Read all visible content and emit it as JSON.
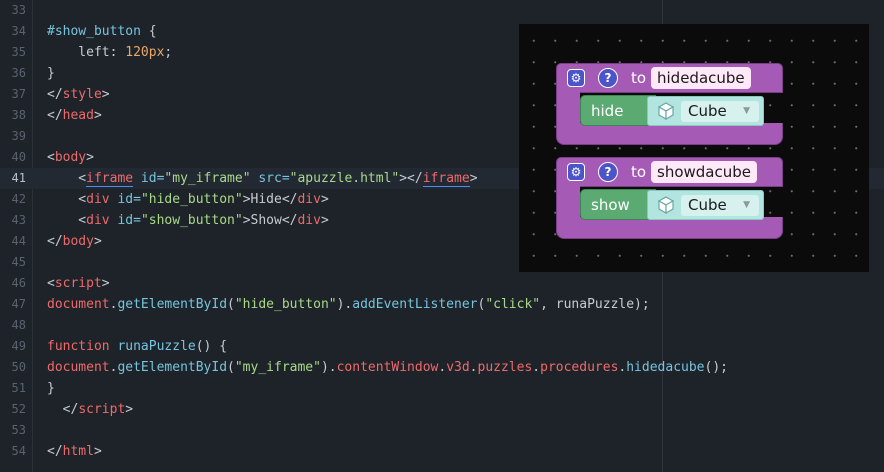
{
  "editor": {
    "current_line": 41,
    "lines": [
      {
        "num": "33",
        "tokens": []
      },
      {
        "num": "34",
        "tokens": [
          {
            "t": "#show_button",
            "c": "sel"
          },
          {
            "t": " {",
            "c": "plain"
          }
        ]
      },
      {
        "num": "35",
        "tokens": [
          {
            "t": "    left: ",
            "c": "plain"
          },
          {
            "t": "120px",
            "c": "num"
          },
          {
            "t": ";",
            "c": "plain"
          }
        ]
      },
      {
        "num": "36",
        "tokens": [
          {
            "t": "}",
            "c": "plain"
          }
        ]
      },
      {
        "num": "37",
        "tokens": [
          {
            "t": "</",
            "c": "plain"
          },
          {
            "t": "style",
            "c": "tag"
          },
          {
            "t": ">",
            "c": "plain"
          }
        ]
      },
      {
        "num": "38",
        "tokens": [
          {
            "t": "</",
            "c": "plain"
          },
          {
            "t": "head",
            "c": "tag"
          },
          {
            "t": ">",
            "c": "plain"
          }
        ]
      },
      {
        "num": "39",
        "tokens": []
      },
      {
        "num": "40",
        "tokens": [
          {
            "t": "<",
            "c": "plain"
          },
          {
            "t": "body",
            "c": "tag"
          },
          {
            "t": ">",
            "c": "plain"
          }
        ]
      },
      {
        "num": "41",
        "tokens": [
          {
            "t": "    <",
            "c": "plain"
          },
          {
            "t": "iframe",
            "c": "iframe"
          },
          {
            "t": " id=",
            "c": "attr"
          },
          {
            "t": "\"my_iframe\"",
            "c": "str"
          },
          {
            "t": " src=",
            "c": "attr"
          },
          {
            "t": "\"apuzzle.html\"",
            "c": "str"
          },
          {
            "t": "></",
            "c": "plain"
          },
          {
            "t": "iframe",
            "c": "iframe"
          },
          {
            "t": ">",
            "c": "plain"
          }
        ]
      },
      {
        "num": "42",
        "tokens": [
          {
            "t": "    <",
            "c": "plain"
          },
          {
            "t": "div",
            "c": "tag"
          },
          {
            "t": " id=",
            "c": "attr"
          },
          {
            "t": "\"hide_button\"",
            "c": "str"
          },
          {
            "t": ">Hide</",
            "c": "plain"
          },
          {
            "t": "div",
            "c": "tag"
          },
          {
            "t": ">",
            "c": "plain"
          }
        ]
      },
      {
        "num": "43",
        "tokens": [
          {
            "t": "    <",
            "c": "plain"
          },
          {
            "t": "div",
            "c": "tag"
          },
          {
            "t": " id=",
            "c": "attr"
          },
          {
            "t": "\"show_button\"",
            "c": "str"
          },
          {
            "t": ">Show</",
            "c": "plain"
          },
          {
            "t": "div",
            "c": "tag"
          },
          {
            "t": ">",
            "c": "plain"
          }
        ]
      },
      {
        "num": "44",
        "tokens": [
          {
            "t": "</",
            "c": "plain"
          },
          {
            "t": "body",
            "c": "tag"
          },
          {
            "t": ">",
            "c": "plain"
          }
        ]
      },
      {
        "num": "45",
        "tokens": []
      },
      {
        "num": "46",
        "tokens": [
          {
            "t": "<",
            "c": "plain"
          },
          {
            "t": "script",
            "c": "tag"
          },
          {
            "t": ">",
            "c": "plain"
          }
        ]
      },
      {
        "num": "47",
        "tokens": [
          {
            "t": "document",
            "c": "kw"
          },
          {
            "t": ".",
            "c": "plain"
          },
          {
            "t": "getElementById",
            "c": "fn"
          },
          {
            "t": "(",
            "c": "plain"
          },
          {
            "t": "\"hide_button\"",
            "c": "str"
          },
          {
            "t": ").",
            "c": "plain"
          },
          {
            "t": "addEventListener",
            "c": "fn"
          },
          {
            "t": "(",
            "c": "plain"
          },
          {
            "t": "\"click\"",
            "c": "str"
          },
          {
            "t": ", runaPuzzle);",
            "c": "plain"
          }
        ]
      },
      {
        "num": "48",
        "tokens": []
      },
      {
        "num": "49",
        "tokens": [
          {
            "t": "function",
            "c": "kw"
          },
          {
            "t": " ",
            "c": "plain"
          },
          {
            "t": "runaPuzzle",
            "c": "fn"
          },
          {
            "t": "() {",
            "c": "plain"
          }
        ]
      },
      {
        "num": "50",
        "tokens": [
          {
            "t": "document",
            "c": "kw"
          },
          {
            "t": ".",
            "c": "plain"
          },
          {
            "t": "getElementById",
            "c": "fn"
          },
          {
            "t": "(",
            "c": "plain"
          },
          {
            "t": "\"my_iframe\"",
            "c": "str"
          },
          {
            "t": ").",
            "c": "plain"
          },
          {
            "t": "contentWindow",
            "c": "kw"
          },
          {
            "t": ".",
            "c": "plain"
          },
          {
            "t": "v3d",
            "c": "kw"
          },
          {
            "t": ".",
            "c": "plain"
          },
          {
            "t": "puzzles",
            "c": "kw"
          },
          {
            "t": ".",
            "c": "plain"
          },
          {
            "t": "procedures",
            "c": "kw"
          },
          {
            "t": ".",
            "c": "plain"
          },
          {
            "t": "hidedacube",
            "c": "fn"
          },
          {
            "t": "();",
            "c": "plain"
          }
        ]
      },
      {
        "num": "51",
        "tokens": [
          {
            "t": "}",
            "c": "plain"
          }
        ]
      },
      {
        "num": "52",
        "tokens": [
          {
            "t": "  </",
            "c": "plain"
          },
          {
            "t": "script",
            "c": "tag"
          },
          {
            "t": ">",
            "c": "plain"
          }
        ]
      },
      {
        "num": "53",
        "tokens": []
      },
      {
        "num": "54",
        "tokens": [
          {
            "t": "</",
            "c": "plain"
          },
          {
            "t": "html",
            "c": "tag"
          },
          {
            "t": ">",
            "c": "plain"
          }
        ]
      }
    ]
  },
  "colors": {
    "background": "#1e2329",
    "procedure_block": "#a55ab5",
    "statement_block": "#5aaa72",
    "object_block": "#b2e4e0",
    "button_blue": "#4c55c8"
  },
  "preview": {
    "procedures": [
      {
        "to_label": "to",
        "name": "hidedacube",
        "settings_icon": "gear-icon",
        "help_icon": "question-icon",
        "statement": {
          "label": "hide",
          "object_icon": "cube-icon",
          "object_value": "Cube",
          "dropdown_icon": "dropdown-arrow-icon"
        }
      },
      {
        "to_label": "to",
        "name": "showdacube",
        "settings_icon": "gear-icon",
        "help_icon": "question-icon",
        "statement": {
          "label": "show",
          "object_icon": "cube-icon",
          "object_value": "Cube",
          "dropdown_icon": "dropdown-arrow-icon"
        }
      }
    ]
  }
}
